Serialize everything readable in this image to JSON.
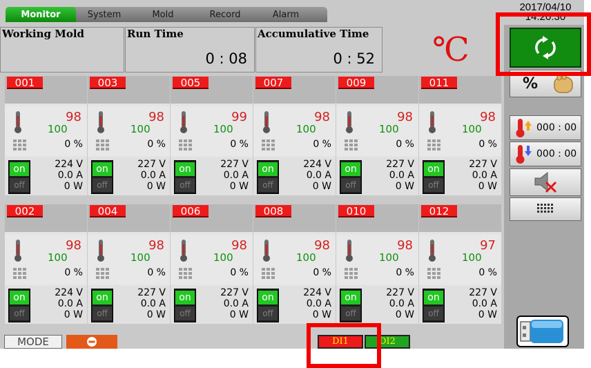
{
  "header": {
    "tabs": [
      "Monitor",
      "System",
      "Mold",
      "Record",
      "Alarm"
    ],
    "active_tab": "Monitor",
    "date": "2017/04/10",
    "time": "14:20:30"
  },
  "info": {
    "working_mold_label": "Working Mold",
    "working_mold_value": "",
    "run_time_label": "Run Time",
    "run_time_value": "0 : 08",
    "accum_label": "Accumulative Time",
    "accum_value": "0 : 52",
    "unit": "℃"
  },
  "sidebar": {
    "percent_label": "%",
    "high_temp_timer": "000 : 00",
    "low_temp_timer": "000 : 00"
  },
  "zones": [
    {
      "id": "001",
      "temp": "98",
      "setpoint": "100",
      "output": "0 %",
      "volt": "224 V",
      "amp": "0.0 A",
      "watt": "0 W",
      "on_label": "on",
      "off_label": "off"
    },
    {
      "id": "003",
      "temp": "98",
      "setpoint": "100",
      "output": "0 %",
      "volt": "227 V",
      "amp": "0.0 A",
      "watt": "0 W",
      "on_label": "on",
      "off_label": "off"
    },
    {
      "id": "005",
      "temp": "99",
      "setpoint": "100",
      "output": "0 %",
      "volt": "227 V",
      "amp": "0.0 A",
      "watt": "0 W",
      "on_label": "on",
      "off_label": "off"
    },
    {
      "id": "007",
      "temp": "98",
      "setpoint": "100",
      "output": "0 %",
      "volt": "224 V",
      "amp": "0.0 A",
      "watt": "0 W",
      "on_label": "on",
      "off_label": "off"
    },
    {
      "id": "009",
      "temp": "98",
      "setpoint": "100",
      "output": "0 %",
      "volt": "227 V",
      "amp": "0.0 A",
      "watt": "0 W",
      "on_label": "on",
      "off_label": "off"
    },
    {
      "id": "011",
      "temp": "98",
      "setpoint": "100",
      "output": "0 %",
      "volt": "227 V",
      "amp": "0.0 A",
      "watt": "0 W",
      "on_label": "on",
      "off_label": "off"
    },
    {
      "id": "002",
      "temp": "98",
      "setpoint": "100",
      "output": "0 %",
      "volt": "224 V",
      "amp": "0.0 A",
      "watt": "0 W",
      "on_label": "on",
      "off_label": "off"
    },
    {
      "id": "004",
      "temp": "98",
      "setpoint": "100",
      "output": "0 %",
      "volt": "227 V",
      "amp": "0.0 A",
      "watt": "0 W",
      "on_label": "on",
      "off_label": "off"
    },
    {
      "id": "006",
      "temp": "98",
      "setpoint": "100",
      "output": "0 %",
      "volt": "227 V",
      "amp": "0.0 A",
      "watt": "0 W",
      "on_label": "on",
      "off_label": "off"
    },
    {
      "id": "008",
      "temp": "98",
      "setpoint": "100",
      "output": "0 %",
      "volt": "224 V",
      "amp": "0.0 A",
      "watt": "0 W",
      "on_label": "on",
      "off_label": "off"
    },
    {
      "id": "010",
      "temp": "98",
      "setpoint": "100",
      "output": "0 %",
      "volt": "227 V",
      "amp": "0.0 A",
      "watt": "0 W",
      "on_label": "on",
      "off_label": "off"
    },
    {
      "id": "012",
      "temp": "97",
      "setpoint": "100",
      "output": "0 %",
      "volt": "227 V",
      "amp": "0.0 A",
      "watt": "0 W",
      "on_label": "on",
      "off_label": "off"
    }
  ],
  "footer": {
    "mode_label": "MODE",
    "di1_label": "DI1",
    "di2_label": "DI2"
  },
  "colors": {
    "active_tab": "#1a9e1a",
    "zone_id_bg": "#ee1b1b",
    "temperature": "#d42020",
    "setpoint": "#109010",
    "annotation": "#f20000"
  },
  "icons": [
    "thermometer-icon",
    "grid-icon",
    "refresh-icon",
    "hand-icon",
    "temp-up-icon",
    "temp-down-icon",
    "mute-icon",
    "keypad-icon",
    "usb-icon",
    "stop-icon"
  ]
}
